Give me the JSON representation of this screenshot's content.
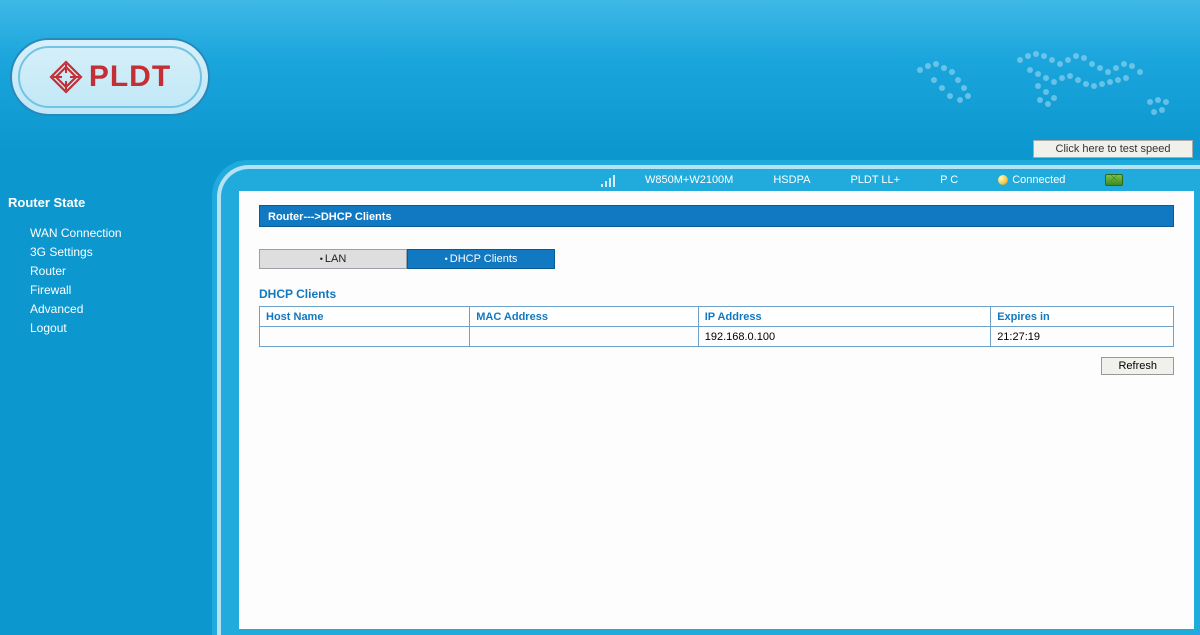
{
  "brand": {
    "name": "PLDT"
  },
  "header": {
    "test_speed_label": "Click here to test speed"
  },
  "status": {
    "band": "W850M+W2100M",
    "mode": "HSDPA",
    "apn": "PLDT LL+",
    "pc": "P C",
    "connection": "Connected"
  },
  "sidebar": {
    "title": "Router State",
    "items": [
      {
        "label": "WAN Connection"
      },
      {
        "label": "3G Settings"
      },
      {
        "label": "Router"
      },
      {
        "label": "Firewall"
      },
      {
        "label": "Advanced"
      },
      {
        "label": "Logout"
      }
    ]
  },
  "breadcrumb": "Router--->DHCP Clients",
  "tabs": {
    "lan": "LAN",
    "dhcp": "DHCP Clients"
  },
  "section_title": "DHCP Clients",
  "table": {
    "columns": [
      "Host Name",
      "MAC Address",
      "IP Address",
      "Expires in"
    ],
    "rows": [
      {
        "host_name": "",
        "mac": "",
        "ip": "192.168.0.100",
        "expires": "21:27:19"
      }
    ]
  },
  "buttons": {
    "refresh": "Refresh"
  }
}
